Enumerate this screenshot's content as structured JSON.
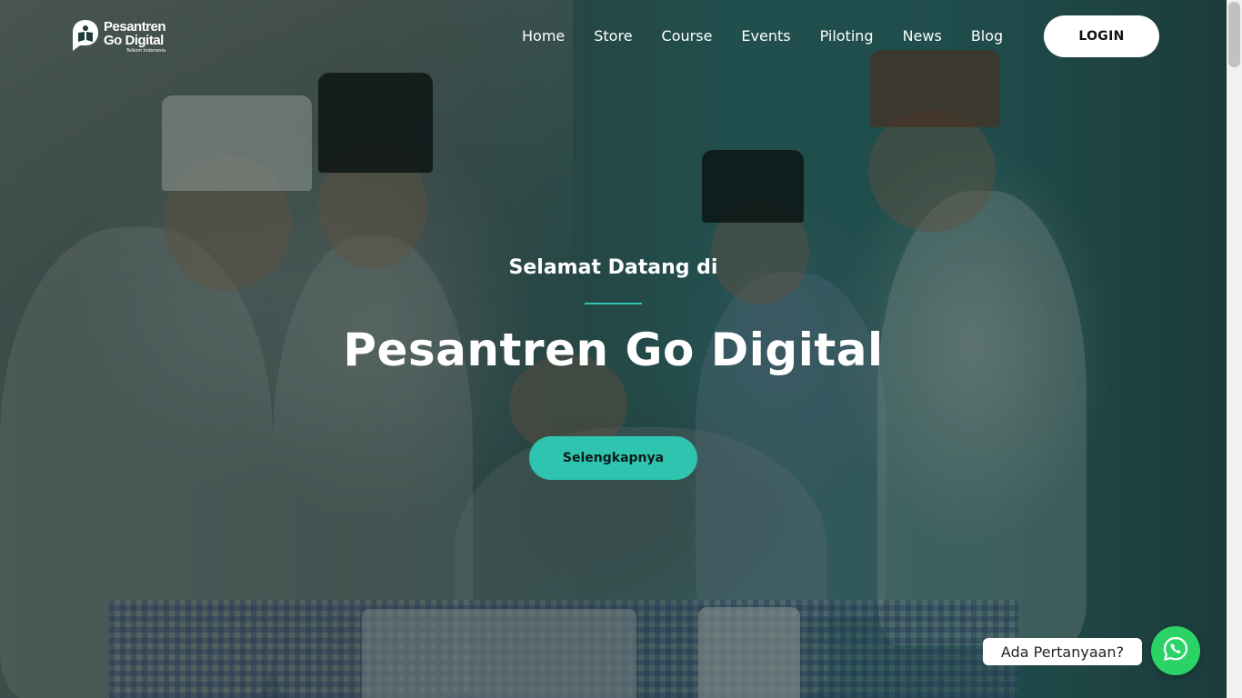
{
  "header": {
    "logo": {
      "line1": "Pesantren",
      "line2": "Go Digital",
      "line3": "Telkom Indonesia"
    },
    "nav": [
      {
        "label": "Home",
        "id": "home"
      },
      {
        "label": "Store",
        "id": "store"
      },
      {
        "label": "Course",
        "id": "course"
      },
      {
        "label": "Events",
        "id": "events"
      },
      {
        "label": "Piloting",
        "id": "piloting"
      },
      {
        "label": "News",
        "id": "news"
      },
      {
        "label": "Blog",
        "id": "blog"
      }
    ],
    "login_label": "LOGIN"
  },
  "hero": {
    "subtitle": "Selamat Datang di",
    "title": "Pesantren Go Digital",
    "cta_label": "Selengkapnya"
  },
  "whatsapp": {
    "bubble_text": "Ada Pertanyaan?",
    "icon": "whatsapp-icon"
  },
  "colors": {
    "accent": "#2ec4b0",
    "whatsapp": "#2bd366",
    "login_bg": "#ffffff"
  }
}
